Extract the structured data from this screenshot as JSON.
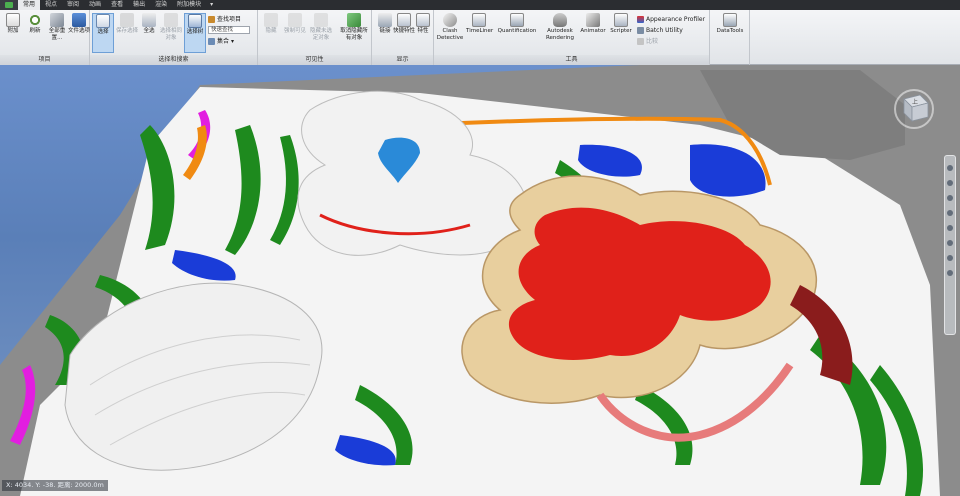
{
  "tabs": [
    "常用",
    "视点",
    "审阅",
    "动画",
    "查看",
    "输出",
    "渲染",
    "附加模块"
  ],
  "tab_extra": "▾",
  "ribbon": {
    "project": {
      "label": "项目",
      "items": [
        "附加",
        "刷新",
        "全部重置...",
        "文件选项"
      ]
    },
    "select": {
      "label": "选择和搜索",
      "items": [
        "选择",
        "保存选择",
        "全选",
        "选择相同对象",
        "选择树"
      ],
      "find": "查找项目",
      "quick_find_placeholder": "快速查找",
      "tool": "集合"
    },
    "visibility": {
      "label": "可见性",
      "items": [
        "隐藏",
        "强制可见",
        "隐藏未选定对象",
        "取消隐藏所有对象"
      ]
    },
    "display": {
      "label": "显示",
      "items": [
        "链接",
        "快捷特性",
        "特性"
      ]
    },
    "tools": {
      "label": "工具",
      "items": [
        "Clash Detective",
        "TimeLiner",
        "Quantification",
        "Autodesk Rendering",
        "Animator",
        "Scripter"
      ],
      "small": [
        "Appearance Profiler",
        "Batch Utility",
        "比较"
      ]
    },
    "datatools": {
      "label": "DataTools"
    }
  },
  "viewcube": {
    "face": "上"
  },
  "status": {
    "text": "X: 4034.  Y: -38.   距离: 2000.0m"
  },
  "colors": {
    "model_red": "#e0211a",
    "model_beige": "#e8cf9e",
    "model_white": "#f2f2f2",
    "model_green": "#1e8a1e",
    "model_blue": "#1a3cd8",
    "model_magenta": "#e21ee0",
    "model_orange": "#f08a12",
    "ground_grey": "#8a8a8a",
    "sky": "#6b90cc"
  }
}
